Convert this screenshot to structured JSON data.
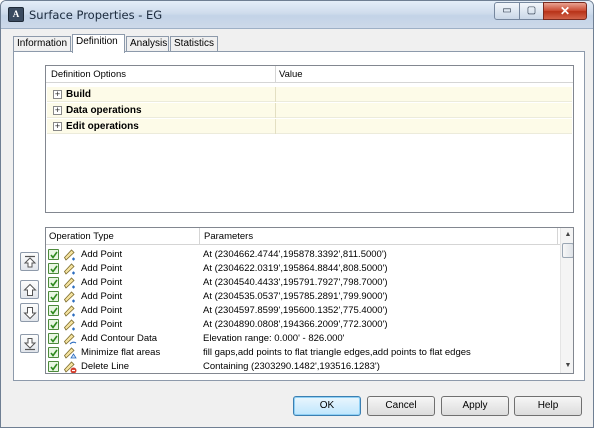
{
  "window": {
    "title": "Surface Properties - EG",
    "app_icon_text": "A",
    "controls": {
      "minimize": "▭",
      "maximize": "▢",
      "close": "✕"
    }
  },
  "tabs": [
    {
      "label": "Information",
      "active": false
    },
    {
      "label": "Definition",
      "active": true
    },
    {
      "label": "Analysis",
      "active": false
    },
    {
      "label": "Statistics",
      "active": false
    }
  ],
  "definition": {
    "headers": {
      "options": "Definition Options",
      "value": "Value"
    },
    "rows": [
      {
        "label": "Build",
        "expander": "+"
      },
      {
        "label": "Data operations",
        "expander": "+"
      },
      {
        "label": "Edit operations",
        "expander": "+"
      }
    ]
  },
  "operations": {
    "headers": {
      "type": "Operation Type",
      "params": "Parameters"
    },
    "rows": [
      {
        "type": "Add Point",
        "params": "At (2304662.4744',195878.3392',811.5000')",
        "icon": "add-point-icon"
      },
      {
        "type": "Add Point",
        "params": "At (2304622.0319',195864.8844',808.5000')",
        "icon": "add-point-icon"
      },
      {
        "type": "Add Point",
        "params": "At (2304540.4433',195791.7927',798.7000')",
        "icon": "add-point-icon"
      },
      {
        "type": "Add Point",
        "params": "At (2304535.0537',195785.2891',799.9000')",
        "icon": "add-point-icon"
      },
      {
        "type": "Add Point",
        "params": "At (2304597.8599',195600.1352',775.4000')",
        "icon": "add-point-icon"
      },
      {
        "type": "Add Point",
        "params": "At (2304890.0808',194366.2009',772.3000')",
        "icon": "add-point-icon"
      },
      {
        "type": "Add Contour Data",
        "params": "Elevation range: 0.000' - 826.000'",
        "icon": "add-contour-icon"
      },
      {
        "type": "Minimize flat areas",
        "params": "fill gaps,add points to flat triangle edges,add points to flat edges",
        "icon": "minimize-flat-icon"
      },
      {
        "type": "Delete Line",
        "params": "Containing (2303290.1482',193516.1283')",
        "icon": "delete-line-icon"
      }
    ]
  },
  "buttons": {
    "ok": "OK",
    "cancel": "Cancel",
    "apply": "Apply",
    "help": "Help"
  },
  "colors": {
    "accent": "#3c7fb1",
    "row_highlight": "#fdfbe8",
    "check_green": "#2f8a1e",
    "delete_red": "#d23a2a"
  }
}
